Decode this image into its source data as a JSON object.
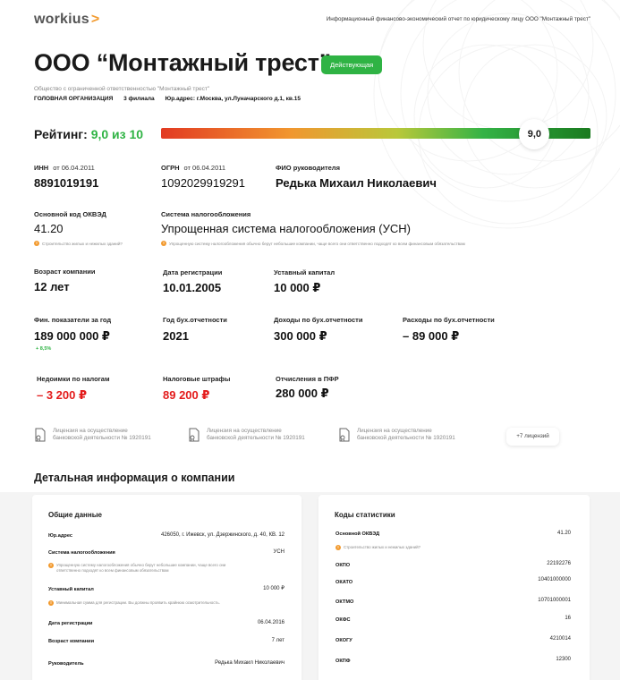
{
  "brand": {
    "logo": "workius",
    "arrow": ">"
  },
  "header": {
    "note": "Информационный финансово-экономический отчет по юридическому лицу ООО \"Монтажный трест\""
  },
  "company": {
    "name": "ООО “Монтажный трест”",
    "status": "Действующая",
    "full_name": "Общество с ограниченной ответственностью \"Монтажный трест\"",
    "org_type": "ГОЛОВНАЯ ОРГАНИЗАЦИЯ",
    "branches": "3 филиала",
    "address": "Юр.адрес: г.Москва, ул.Луначарского д.1, кв.15"
  },
  "rating": {
    "label": "Рейтинг:",
    "value_text": "9,0 из 10",
    "marker": "9,0",
    "score": 9.0,
    "max": 10
  },
  "fields": {
    "inn_label": "ИНН",
    "inn_date": "от 06.04.2011",
    "inn_value": "8891019191",
    "ogrn_label": "ОГРН",
    "ogrn_date": "от 06.04.2011",
    "ogrn_value": "1092029919291",
    "director_label": "ФИО руководителя",
    "director_value": "Редька Михаил Николаевич",
    "okved_label": "Основной код ОКВЭД",
    "okved_value": "41.20",
    "okved_hint": "Строительство жилых и нежилых зданий?",
    "tax_label": "Система налогообложения",
    "tax_value": "Упрощенная система налогообложения (УСН)",
    "tax_hint": "Упрощенную систему налогообложения обычно берут небольшие компании, чаще всего они ответственно подходят ко всем финансовым обязательствам",
    "age_label": "Возраст компании",
    "age_value": "12 лет",
    "reg_label": "Дата регистрации",
    "reg_value": "10.01.2005",
    "capital_label": "Уставный капитал",
    "capital_value": "10 000 ₽",
    "fin_label": "Фин. показатели за год",
    "fin_value": "189 000 000 ₽",
    "fin_growth": "+ 8,5%",
    "year_label": "Год бух.отчетности",
    "year_value": "2021",
    "income_label": "Доходы по бух.отчетности",
    "income_value": "300 000 ₽",
    "expense_label": "Расходы по бух.отчетности",
    "expense_value": "– 89 000 ₽",
    "arrears_label": "Недоимки по налогам",
    "arrears_value": "– 3 200 ₽",
    "fines_label": "Налоговые штрафы",
    "fines_value": "89 200 ₽",
    "pfr_label": "Отчисления в ПФР",
    "pfr_value": "280 000 ₽"
  },
  "licenses": [
    {
      "line1": "Лицензия на осуществление",
      "line2": "банковской деятельности № 1920191"
    },
    {
      "line1": "Лицензия на осуществление",
      "line2": "банковской деятельности № 1920191"
    },
    {
      "line1": "Лицензия на осуществление",
      "line2": "банковской деятельности № 1920191"
    }
  ],
  "licenses_more": "+7 лицензий",
  "details_title": "Детальная информация о компании",
  "general": {
    "title": "Общие данные",
    "address_label": "Юр.адрес",
    "address_value": "426050, г. Ижевск, ул. Дзержинского, д. 40, КВ. 12",
    "tax_label": "Система налогообложения",
    "tax_value": "УСН",
    "tax_hint": "Упрощенную систему налогообложения обычно берут небольшие компании, чаще всего они ответственно подходят ко всем финансовым обязательствам",
    "capital_label": "Уставный капитал",
    "capital_value": "10 000 ₽",
    "capital_hint": "Минимальная сумма для регистрации. Вы должны проявить крайнюю осмотрительность.",
    "reg_label": "Дата регистрации",
    "reg_value": "06.04.2016",
    "age_label": "Возраст компании",
    "age_value": "7 лет",
    "director_label": "Руководитель",
    "director_value": "Редька Михаил Николаевич"
  },
  "stats": {
    "title": "Коды статистики",
    "okved_label": "Основной ОКВЭД",
    "okved_value": "41.20",
    "okved_hint": "Строительство жилых и нежилых зданий?",
    "okpo_label": "ОКПО",
    "okpo_value": "22192276",
    "okato_label": "ОКАТО",
    "okato_value": "10401000000",
    "oktmo_label": "ОКТМО",
    "oktmo_value": "10701000001",
    "okfs_label": "ОКФС",
    "okfs_value": "16",
    "okogu_label": "ОКОГУ",
    "okogu_value": "4210014",
    "okopf_label": "ОКПФ",
    "okopf_value": "12300"
  }
}
